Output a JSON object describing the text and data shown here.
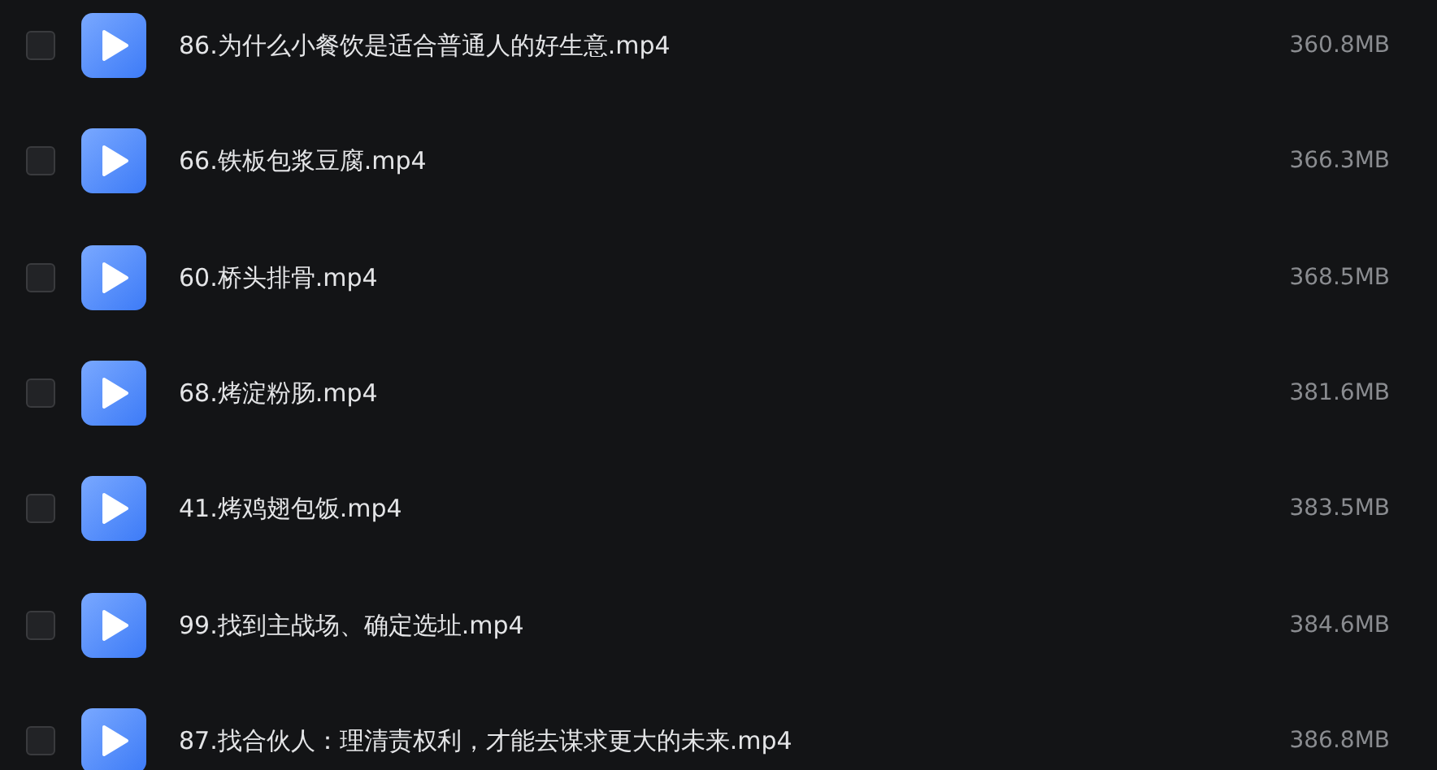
{
  "files": [
    {
      "name": "86.为什么小餐饮是适合普通人的好生意.mp4",
      "size": "360.8MB",
      "checked": false
    },
    {
      "name": "66.铁板包浆豆腐.mp4",
      "size": "366.3MB",
      "checked": false
    },
    {
      "name": "60.桥头排骨.mp4",
      "size": "368.5MB",
      "checked": false
    },
    {
      "name": "68.烤淀粉肠.mp4",
      "size": "381.6MB",
      "checked": false
    },
    {
      "name": "41.烤鸡翅包饭.mp4",
      "size": "383.5MB",
      "checked": false
    },
    {
      "name": "99.找到主战场、确定选址.mp4",
      "size": "384.6MB",
      "checked": false
    },
    {
      "name": "87.找合伙人：理清责权利，才能去谋求更大的未来.mp4",
      "size": "386.8MB",
      "checked": false
    }
  ]
}
